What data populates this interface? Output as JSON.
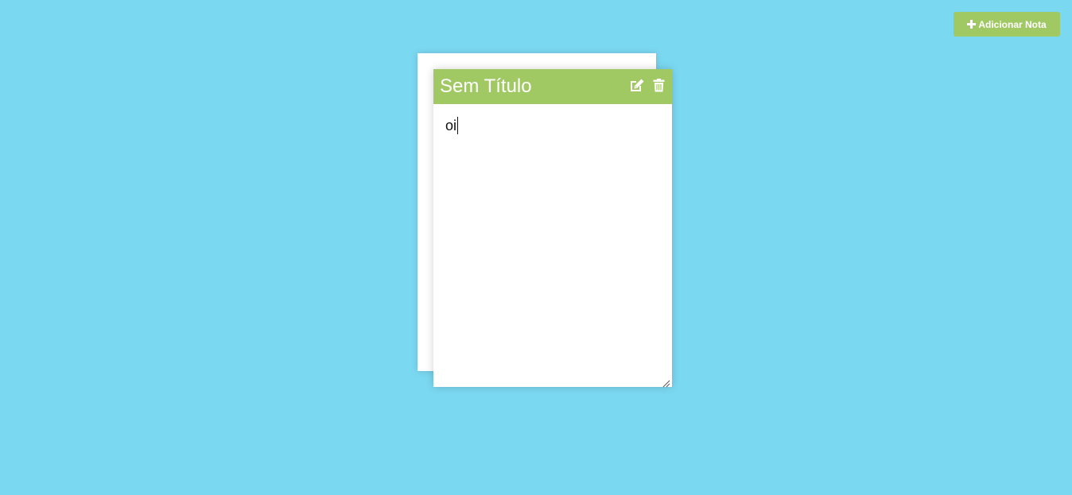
{
  "toolbar": {
    "add_note_label": "Adicionar Nota",
    "add_icon": "plus-icon"
  },
  "note": {
    "title": "Sem Título",
    "content": "oi",
    "edit_icon": "edit-icon",
    "delete_icon": "trash-icon"
  },
  "colors": {
    "background": "#7bd8f1",
    "accent": "#a1c963",
    "note_bg": "#ffffff"
  }
}
